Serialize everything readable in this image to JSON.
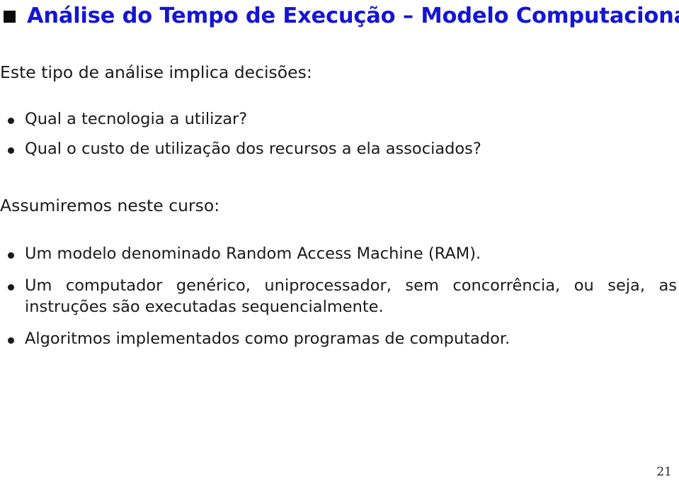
{
  "slide": {
    "title": "Análise do Tempo de Execução – Modelo Computacional",
    "title_color": "#1515d4",
    "marker_color": "#0a0a0a",
    "page_number": "21",
    "intro_paragraph": "Este tipo de análise implica decisões:",
    "decisions": [
      {
        "text": "Qual a tecnologia a utilizar?"
      },
      {
        "text": "Qual o custo de utilização dos recursos a ela associados?"
      }
    ],
    "assumptions_heading": "Assumiremos neste curso:",
    "assumptions": [
      {
        "text": "Um modelo denominado Random Access Machine (RAM)."
      },
      {
        "text": "Um computador genérico, uniprocessador, sem concorrência, ou seja, as instruções são executadas sequencialmente."
      },
      {
        "text": "Algoritmos implementados como programas de computador."
      }
    ]
  }
}
